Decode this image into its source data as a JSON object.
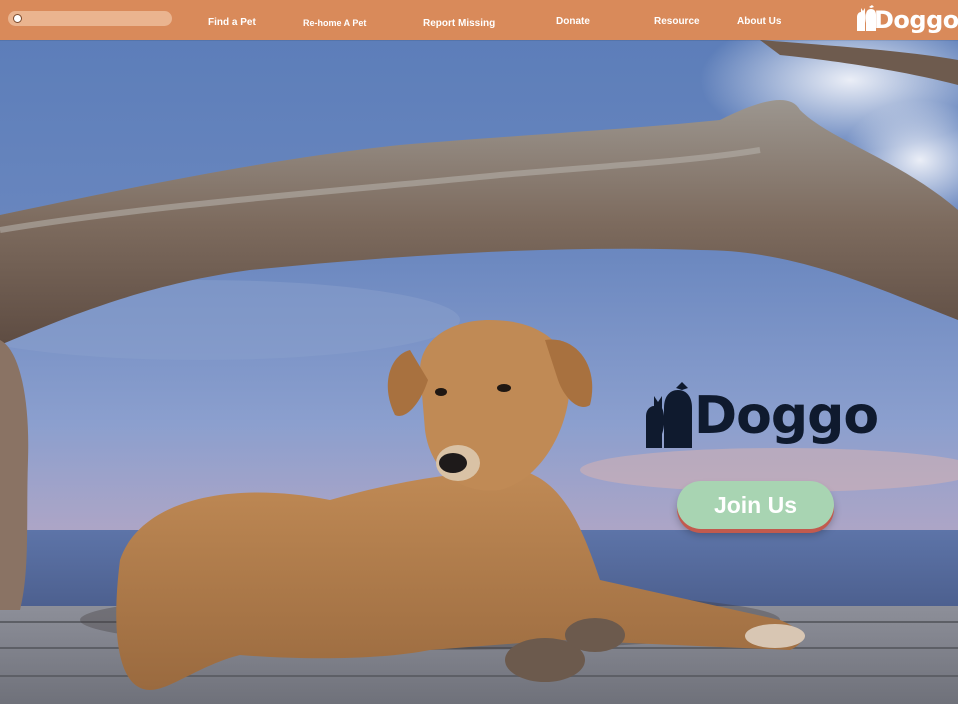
{
  "nav": {
    "items": [
      {
        "label": "Find a Pet"
      },
      {
        "label": "Re-home A Pet"
      },
      {
        "label": "Report Missing"
      },
      {
        "label": "Donate"
      },
      {
        "label": "Resource"
      },
      {
        "label": "About Us"
      }
    ],
    "brand": "Doggo",
    "search_icon": "search-icon",
    "color": "#d98a5a"
  },
  "hero": {
    "logo_text": "Doggo",
    "join_label": "Join Us",
    "join_color": "#a8d4b2"
  }
}
